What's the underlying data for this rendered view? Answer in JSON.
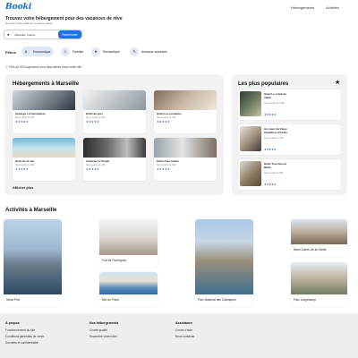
{
  "header": {
    "logo": "Booki",
    "nav": [
      "Hébergements",
      "Activités"
    ]
  },
  "hero": {
    "title": "Trouvez votre hébergement pour des vacances de rêve",
    "subtitle": "En plein centre-ville ou en pleine nature",
    "search_value": "Marseille, France",
    "search_button": "Rechercher"
  },
  "filters": {
    "label": "Filtres",
    "items": [
      {
        "icon": "money-icon",
        "label": "Économique",
        "active": true
      },
      {
        "icon": "child-icon",
        "label": "Familial",
        "active": false
      },
      {
        "icon": "heart-icon",
        "label": "Romantique",
        "active": false
      },
      {
        "icon": "dog-icon",
        "label": "Animaux autorisés",
        "active": false
      }
    ]
  },
  "info_text": "Plus de 500 logements sont disponibles dans cette ville",
  "accommodations": {
    "title": "Hébergements à Marseille",
    "cards": [
      {
        "name": "Auberge La Cannebière",
        "price": "Nuit à partir de 25€",
        "stars": "★★★★★",
        "rating": 2
      },
      {
        "name": "Hôtel du port",
        "price": "Nuit à partir de 52€",
        "stars": "★★★★★",
        "rating": 4
      },
      {
        "name": "Hôtel Les mouettes",
        "price": "Nuit à partir de 76€",
        "stars": "★★★★★",
        "rating": 5
      },
      {
        "name": "Hôtel de la mer",
        "price": "Nuit à partir de 46€",
        "stars": "★★★★★",
        "rating": 3
      },
      {
        "name": "Auberge Le Panier",
        "price": "Nuit à partir de 23€",
        "stars": "★★★★★",
        "rating": 4
      },
      {
        "name": "Hôtel chez Amine",
        "price": "Nuit à partir de 96€",
        "stars": "★★★★★",
        "rating": 4
      }
    ],
    "more": "Afficher plus"
  },
  "popular": {
    "title": "Les plus populaires",
    "items": [
      {
        "name": "Hôtel Le soleil du matin",
        "price": "Nuit à partir de 128€",
        "stars": "★★★★★",
        "rating": 4
      },
      {
        "name": "Au cœur du Vieux Chambres d'hôtes",
        "price": "Nuit à partir de 71€",
        "stars": "★★★★★",
        "rating": 4
      },
      {
        "name": "Hôtel Tout bleu et Blanc",
        "price": "Nuit à partir de 68€",
        "stars": "★★★★★",
        "rating": 4
      }
    ]
  },
  "activities": {
    "title": "Activités à Marseille",
    "items": [
      "Vieux Port",
      "Fort de Pomègues",
      "Îles du Frioul",
      "Parc National des Calanques",
      "Notre-Dame-de-la-Garde",
      "Parc Longchamp"
    ]
  },
  "footer": {
    "columns": [
      {
        "title": "À propos",
        "links": [
          "Fonctionnement du site",
          "Conditions générales de vente",
          "Données et confidentialité"
        ]
      },
      {
        "title": "Nos hébergements",
        "links": [
          "Charte qualité",
          "Soumettre votre hôtel"
        ]
      },
      {
        "title": "Assistance",
        "links": [
          "Centre d'aide",
          "Nous contacter"
        ]
      }
    ]
  },
  "colors": {
    "brand": "#0a6bd9",
    "accent": "#1a73e8",
    "chip": "#dfe8f5",
    "panel": "#f2f2f2"
  }
}
